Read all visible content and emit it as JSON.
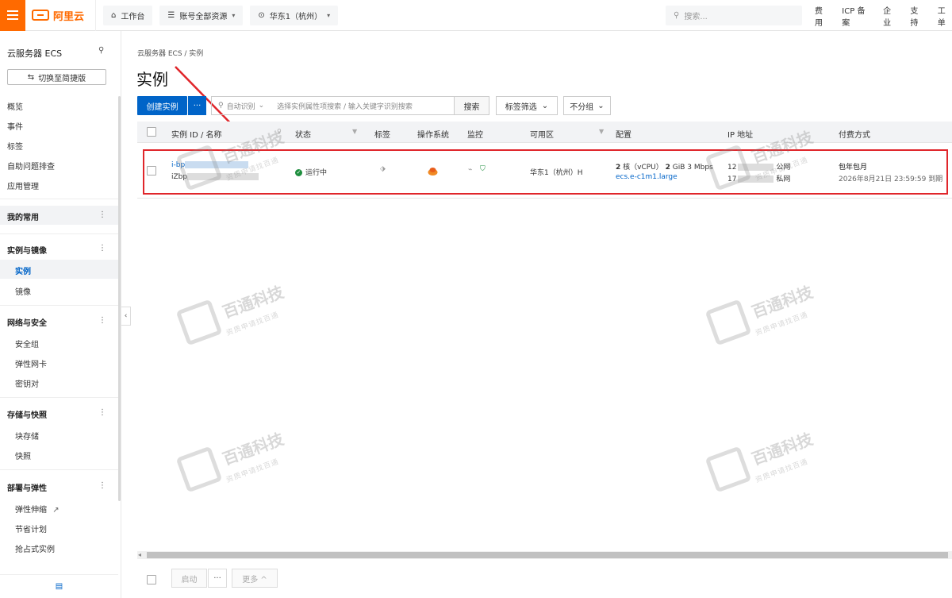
{
  "topbar": {
    "brand": "阿里云",
    "workbench": "工作台",
    "resource_scope": "账号全部资源",
    "region": "华东1（杭州）",
    "search_placeholder": "搜索...",
    "links": [
      "费用",
      "ICP 备案",
      "企业",
      "支持",
      "工单"
    ]
  },
  "sidebar": {
    "title": "云服务器 ECS",
    "switch_label": "切换至简捷版",
    "top_items": [
      "概览",
      "事件",
      "标签",
      "自助问题排查",
      "应用管理"
    ],
    "favorites": "我的常用",
    "groups": [
      {
        "label": "实例与镜像",
        "items": [
          "实例",
          "镜像"
        ]
      },
      {
        "label": "网络与安全",
        "items": [
          "安全组",
          "弹性网卡",
          "密钥对"
        ]
      },
      {
        "label": "存储与快照",
        "items": [
          "块存储",
          "快照"
        ]
      },
      {
        "label": "部署与弹性",
        "items": [
          "弹性伸缩",
          "节省计划",
          "抢占式实例"
        ]
      }
    ]
  },
  "main": {
    "breadcrumb": "云服务器 ECS  /  实例",
    "title": "实例",
    "create_button": "创建实例",
    "more_button": "···",
    "search_mode": "自动识别",
    "search_placeholder": "选择实例属性项搜索 / 输入关键字识别搜索",
    "search_button": "搜索",
    "tag_filter": "标签筛选",
    "group_select": "不分组",
    "columns": [
      "实例 ID / 名称",
      "状态",
      "标签",
      "操作系统",
      "监控",
      "可用区",
      "配置",
      "IP 地址",
      "付费方式"
    ],
    "row": {
      "id_prefix": "i-bp",
      "name_prefix": "iZbp",
      "status": "运行中",
      "zone": "华东1（杭州）H",
      "config_cpu": "2",
      "config_cpu_label": "核（vCPU）",
      "config_mem": "2",
      "config_mem_label": "GiB 3 Mbps",
      "instance_type": "ecs.e-c1m1.large",
      "ip_public_prefix": "12",
      "ip_public_label": "公网",
      "ip_private_prefix": "17",
      "ip_private_label": "私网",
      "billing": "包年包月",
      "expire": "2026年8月21日 23:59:59",
      "expire_label": "到期"
    },
    "footer": {
      "start": "启动",
      "dots": "···",
      "more": "更多 ^"
    }
  },
  "watermark": {
    "text": "百通科技",
    "sub": "资质申请找百通"
  },
  "colors": {
    "brand": "#ff6a00",
    "primary": "#0064c8",
    "highlight": "#e0262b",
    "running": "#1e8e3e"
  }
}
